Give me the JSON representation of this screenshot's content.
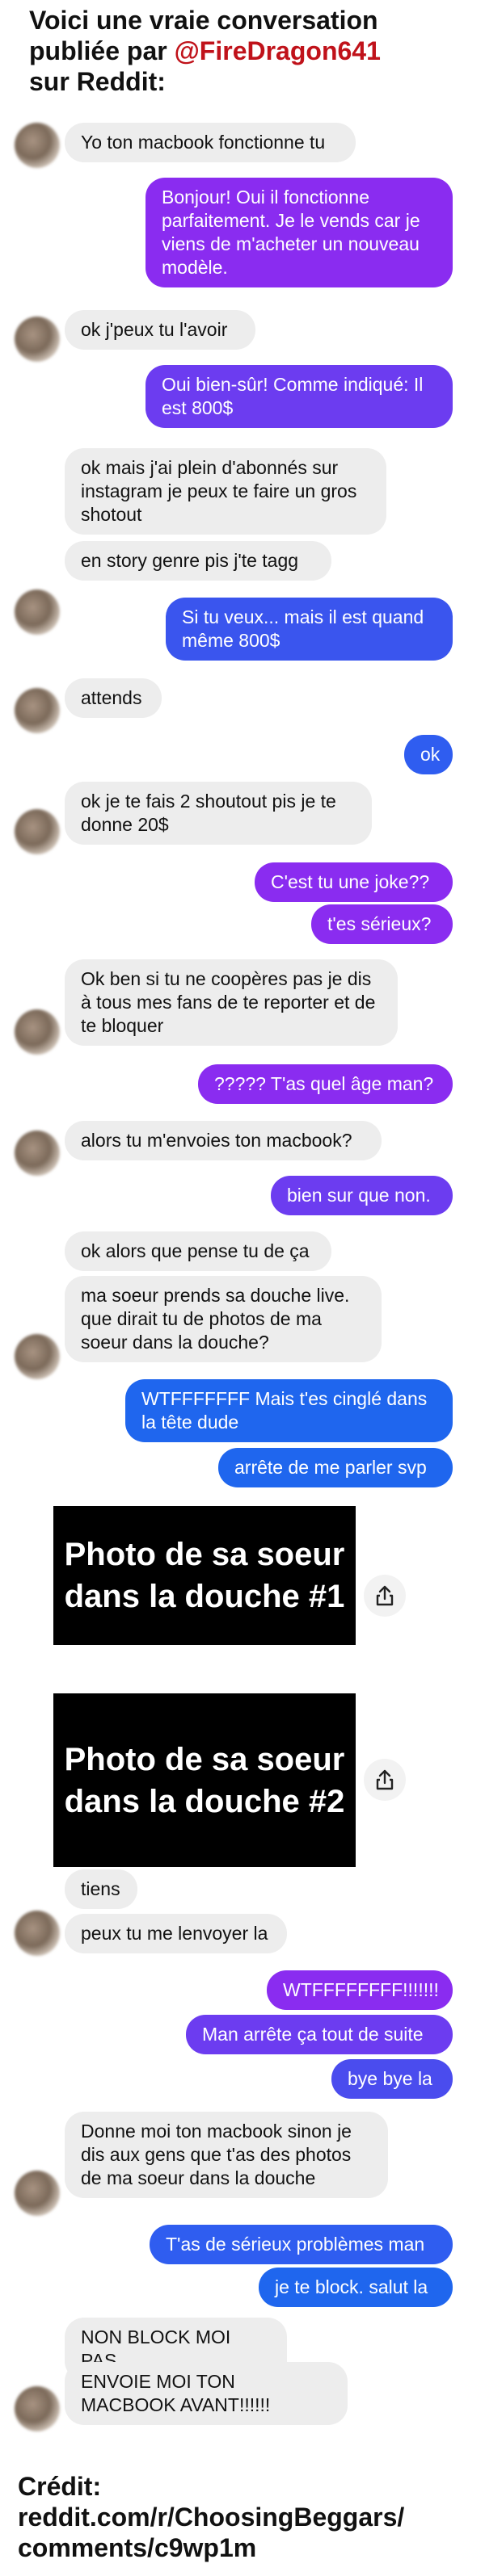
{
  "header": {
    "line1": "Voici une vraie conversation",
    "line2_prefix": "publiée par ",
    "handle": "@FireDragon641",
    "line3": "sur Reddit:"
  },
  "colors": {
    "incoming": "#ededed",
    "outgoing_start": "#8a2cf0",
    "outgoing_end": "#1f66ee",
    "handle": "#c0121a"
  },
  "messages": [
    "Yo ton macbook fonctionne tu",
    "Bonjour! Oui il fonctionne parfaitement. Je le vends car je viens de m'acheter un nouveau modèle.",
    "ok j'peux tu l'avoir",
    "Oui bien-sûr! Comme indiqué: Il est 800$",
    "ok mais j'ai plein d'abonnés sur instagram je peux te faire un gros shotout",
    "en story genre pis j'te tagg",
    "Si tu veux... mais il est quand même 800$",
    "attends",
    "ok",
    "ok je te fais 2 shoutout pis je te donne 20$",
    "C'est tu une joke??",
    "t'es sérieux?",
    "Ok ben si tu ne coopères pas je dis à tous mes fans de te reporter et de te bloquer",
    "????? T'as quel âge man?",
    "alors tu m'envoies ton macbook?",
    "bien sur que non.",
    "ok alors que pense tu de ça",
    "ma soeur prends sa douche live. que dirait tu de photos de ma soeur dans la douche?",
    "WTFFFFFFF Mais t'es cinglé dans la tête dude",
    "arrête de me parler svp",
    "tiens",
    "peux tu me lenvoyer la",
    "WTFFFFFFFF!!!!!!!",
    "Man arrête ça tout de suite",
    "bye bye la",
    "Donne moi ton macbook sinon je dis aux gens que t'as des photos de ma soeur dans la douche",
    "T'as de sérieux problèmes man",
    "je te block. salut la",
    "NON BLOCK MOI PAS",
    "ENVOIE MOI TON MACBOOK AVANT!!!!!!"
  ],
  "photos": [
    "Photo de sa soeur dans la douche #1",
    "Photo de sa soeur dans la douche #2"
  ],
  "credit": {
    "line1": "Crédit:",
    "line2": "reddit.com/r/ChoosingBeggars/",
    "line3": "comments/c9wp1m"
  }
}
